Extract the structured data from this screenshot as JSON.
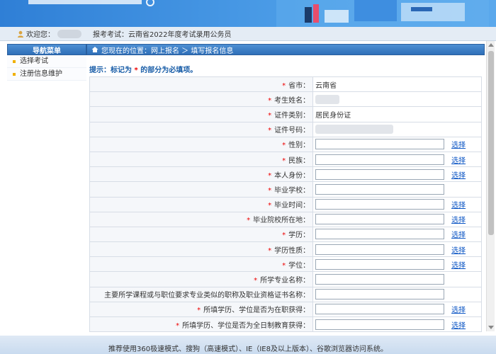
{
  "colors": {
    "brand_blue": "#2f7fd6",
    "header_bar": "#2f6fb8",
    "required_star": "#ee0000",
    "link": "#0b55c4"
  },
  "topbar": {
    "welcome": "欢迎您：",
    "exam_label": "报考考试：",
    "exam_name": "云南省2022年度考试录用公务员"
  },
  "sidebar": {
    "title": "导航菜单",
    "items": [
      {
        "label": "选择考试"
      },
      {
        "label": "注册信息维护"
      }
    ]
  },
  "breadcrumb": {
    "text": "您现在的位置：网上报名 ＞ 填写报名信息"
  },
  "tip": {
    "prefix": "提示：标记为",
    "star": "*",
    "suffix": "的部分为必填项。"
  },
  "form": {
    "select_label": "选择",
    "rows": [
      {
        "label": "省市：",
        "required": "*",
        "value": "云南省"
      },
      {
        "label": "考生姓名：",
        "required": "*",
        "value": ""
      },
      {
        "label": "证件类别：",
        "required": "*",
        "value": "居民身份证"
      },
      {
        "label": "证件号码：",
        "required": "*",
        "value": ""
      },
      {
        "label": "性别：",
        "required": "*"
      },
      {
        "label": "民族：",
        "required": "*"
      },
      {
        "label": "本人身份：",
        "required": "*"
      },
      {
        "label": "毕业学校：",
        "required": "*"
      },
      {
        "label": "毕业时间：",
        "required": "*"
      },
      {
        "label": "毕业院校所在地：",
        "required": "*"
      },
      {
        "label": "学历：",
        "required": "*"
      },
      {
        "label": "学历性质：",
        "required": "*"
      },
      {
        "label": "学位：",
        "required": "*"
      },
      {
        "label": "所学专业名称：",
        "required": "*"
      },
      {
        "label": "主要所学课程或与职位要求专业类似的职称及职业资格证书名称：",
        "required": ""
      },
      {
        "label": "所填学历、学位是否为在职获得：",
        "required": "*"
      },
      {
        "label": "所填学历、学位是否为全日制教育获得：",
        "required": "*"
      }
    ]
  },
  "footer": {
    "text": "推荐使用360极速模式、搜狗（高速模式）、IE（IE8及以上版本）、谷歌浏览器访问系统。"
  }
}
